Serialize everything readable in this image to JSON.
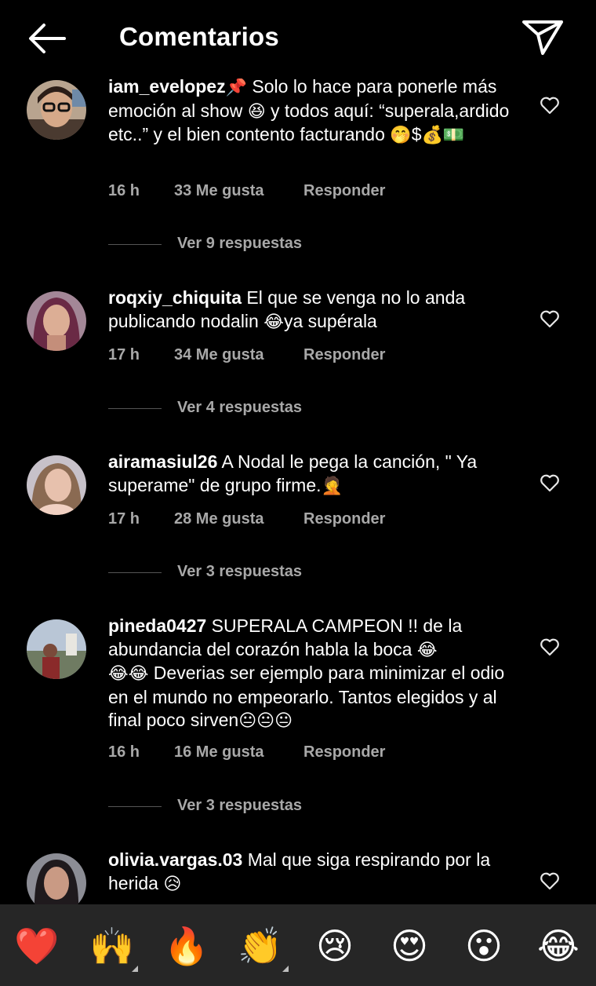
{
  "header": {
    "title": "Comentarios"
  },
  "comments": [
    {
      "username": "iam_evelopez",
      "text_before": " Solo lo hace para ponerle más emoción al show ",
      "text_middle": " y todos aquí: “superala,ardido etc..” y el bien contento facturando ",
      "emoji_pin": "📌",
      "emoji_laugh": "😆",
      "emoji_hush": "🤭",
      "money_sign": "$",
      "emoji_bag": "💰",
      "emoji_cash": "💵",
      "time": "16 h",
      "likes": "33 Me gusta",
      "reply": "Responder",
      "view_replies": "Ver 9 respuestas"
    },
    {
      "username": "roqxiy_chiquita",
      "text": " El que se venga no lo anda publicando nodalin ",
      "emoji": "😂",
      "text_after": "ya supérala",
      "time": "17 h",
      "likes": "34 Me gusta",
      "reply": "Responder",
      "view_replies": "Ver 4 respuestas"
    },
    {
      "username": "airamasiul26",
      "text": " A Nodal le pega la canción, \" Ya superame\" de grupo firme.",
      "emoji": "🤦",
      "time": "17 h",
      "likes": "28 Me gusta",
      "reply": "Responder",
      "view_replies": "Ver 3 respuestas"
    },
    {
      "username": "pineda0427",
      "text": " SUPERALA CAMPEON !! de la abundancia del corazón habla la boca ",
      "emoji_a": "😂",
      "emoji_b": "😂😂",
      "text_after": " Deverias ser ejemplo para minimizar el odio en el mundo no empeorarlo. Tantos elegidos y al final poco sirven",
      "emoji_end": "😐😐😐",
      "time": "16 h",
      "likes": "16 Me gusta",
      "reply": "Responder",
      "view_replies": "Ver 3 respuestas"
    },
    {
      "username": "olivia.vargas.03",
      "text": " Mal que siga respirando por la herida ",
      "emoji": "😥"
    }
  ],
  "emoji_bar": [
    "❤️",
    "🙌",
    "🔥",
    "👏",
    "😢",
    "😍",
    "😮",
    "😂"
  ],
  "colors": {
    "background": "#000000",
    "muted_text": "#a8a8a8",
    "emoji_bar_bg": "#262626",
    "heart_red": "#e0202a"
  }
}
